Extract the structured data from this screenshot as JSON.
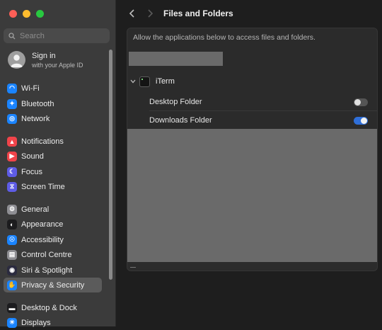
{
  "window": {
    "traffic_lights": {
      "close": "#fe5f57",
      "minimize": "#febc2e",
      "zoom": "#28c840"
    }
  },
  "sidebar": {
    "search_placeholder": "Search",
    "account": {
      "title": "Sign in",
      "subtitle": "with your Apple ID"
    },
    "items": [
      {
        "label": "Wi-Fi",
        "icon": "wifi-icon",
        "color": "#1a84ff"
      },
      {
        "label": "Bluetooth",
        "icon": "bluetooth-icon",
        "color": "#1a84ff"
      },
      {
        "label": "Network",
        "icon": "globe-icon",
        "color": "#1a84ff"
      },
      {
        "label": "Notifications",
        "icon": "bell-icon",
        "color": "#f0444a"
      },
      {
        "label": "Sound",
        "icon": "speaker-icon",
        "color": "#f0444a"
      },
      {
        "label": "Focus",
        "icon": "moon-icon",
        "color": "#5e5ce6"
      },
      {
        "label": "Screen Time",
        "icon": "hourglass-icon",
        "color": "#5e5ce6"
      },
      {
        "label": "General",
        "icon": "gear-icon",
        "color": "#8e8e93"
      },
      {
        "label": "Appearance",
        "icon": "appearance-icon",
        "color": "#1c1c1e"
      },
      {
        "label": "Accessibility",
        "icon": "accessibility-icon",
        "color": "#1a84ff"
      },
      {
        "label": "Control Centre",
        "icon": "control-centre-icon",
        "color": "#8e8e93"
      },
      {
        "label": "Siri & Spotlight",
        "icon": "siri-icon",
        "color": "#2b2b3f"
      },
      {
        "label": "Privacy & Security",
        "icon": "hand-icon",
        "color": "#1a84ff",
        "active": true
      },
      {
        "label": "Desktop & Dock",
        "icon": "dock-icon",
        "color": "#1c1c1e"
      },
      {
        "label": "Displays",
        "icon": "display-icon",
        "color": "#1a84ff"
      }
    ]
  },
  "main": {
    "title": "Files and Folders",
    "description": "Allow the applications below to access files and folders.",
    "app": {
      "name": "iTerm"
    },
    "permissions": [
      {
        "label": "Desktop Folder",
        "enabled": false
      },
      {
        "label": "Downloads Folder",
        "enabled": true
      }
    ]
  }
}
